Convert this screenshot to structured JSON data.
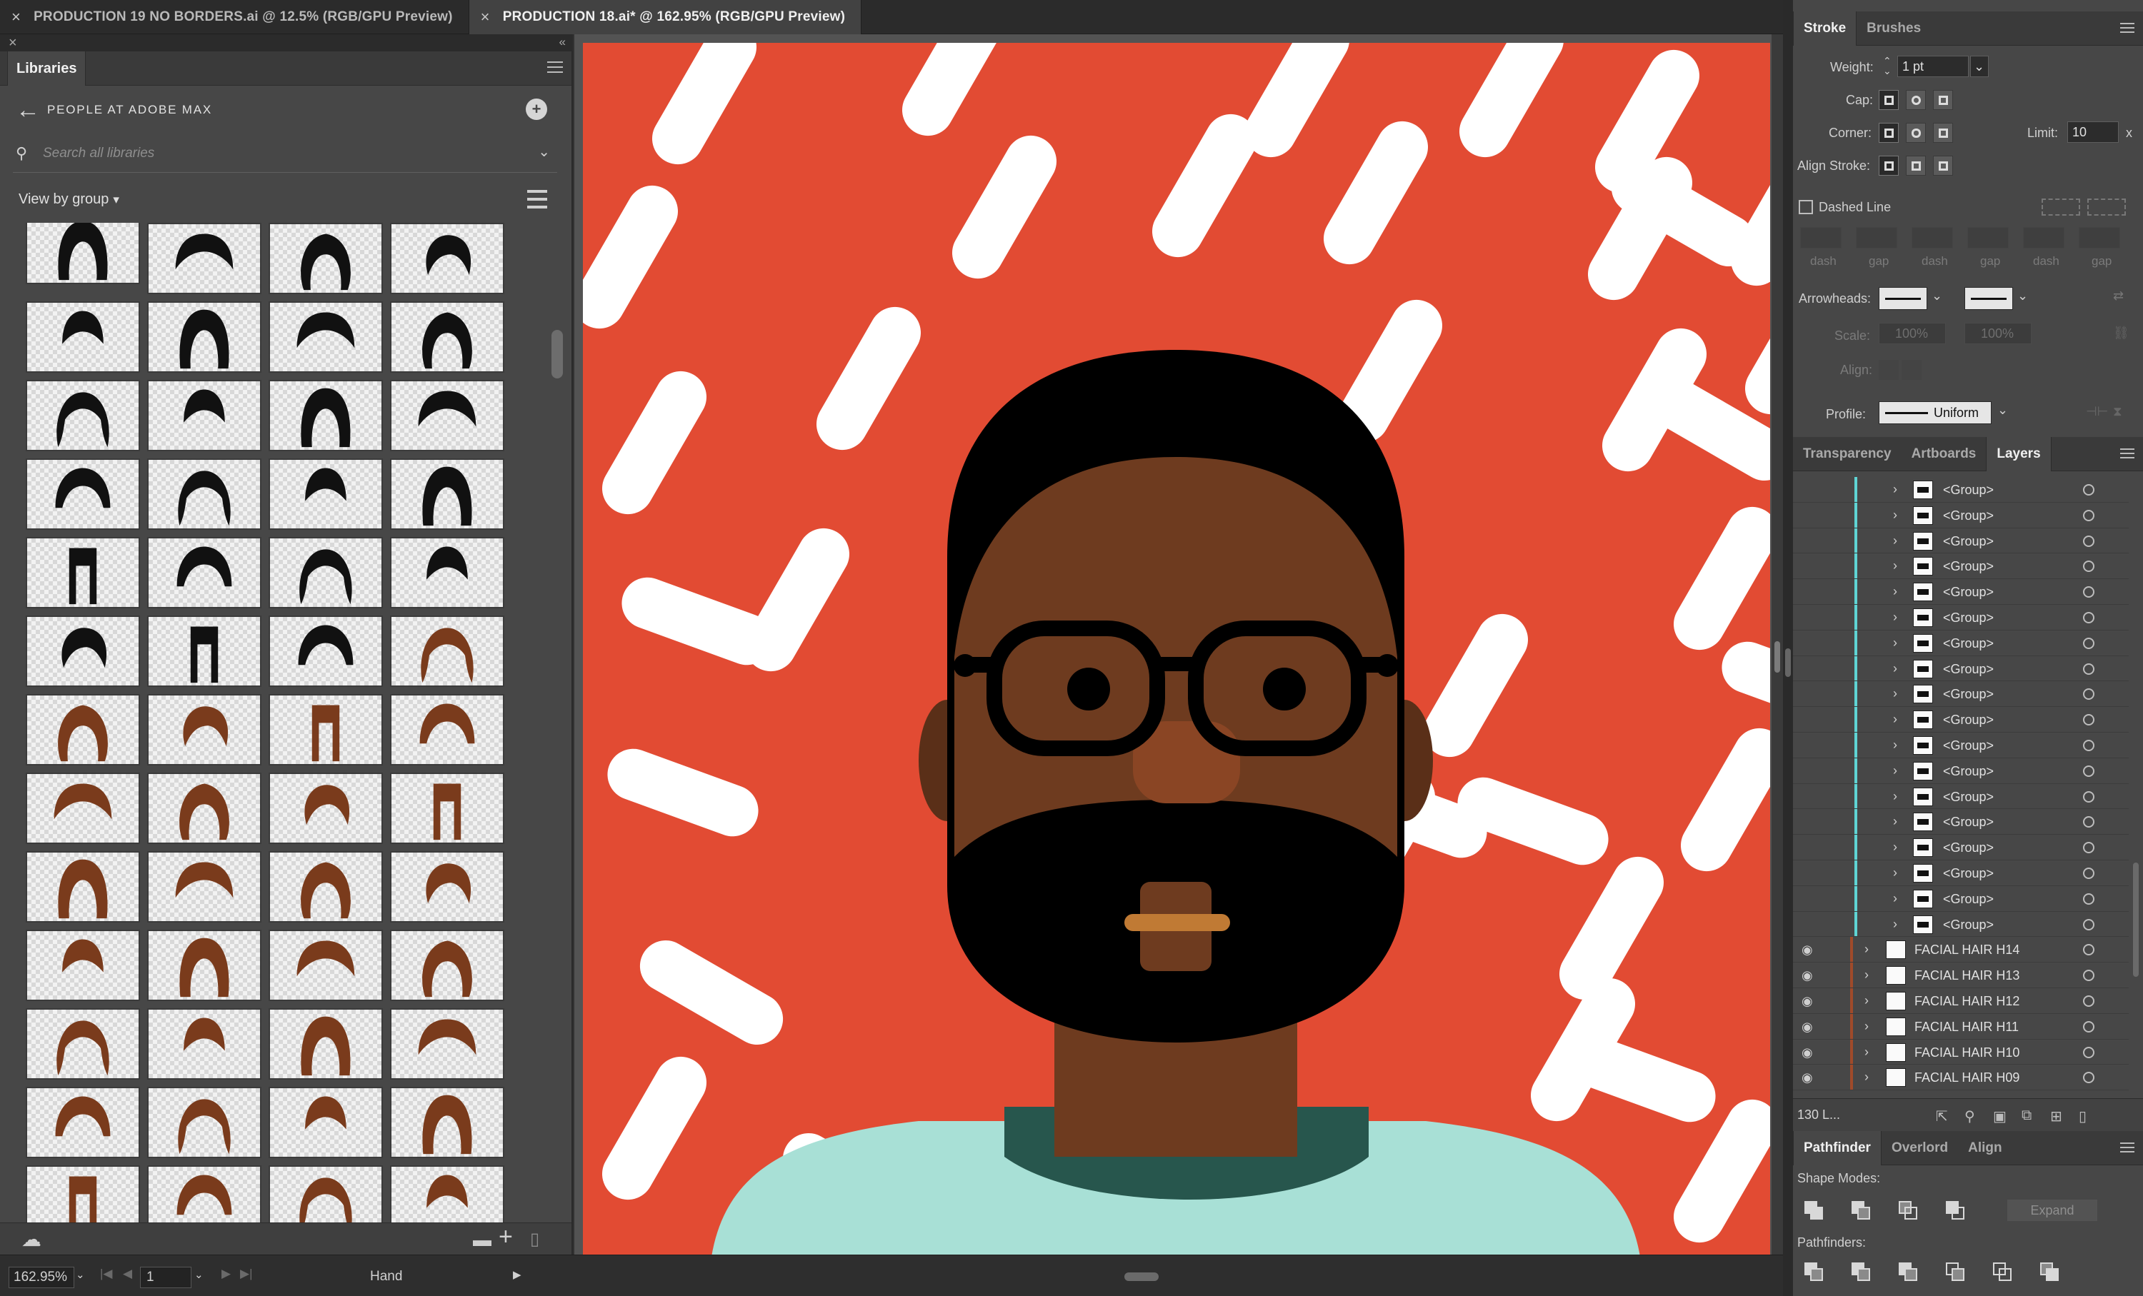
{
  "document_tabs": [
    {
      "label": "PRODUCTION 19 NO BORDERS.ai @ 12.5% (RGB/GPU Preview)",
      "active": false
    },
    {
      "label": "PRODUCTION 18.ai* @ 162.95% (RGB/GPU Preview)",
      "active": true
    }
  ],
  "libraries": {
    "tab_label": "Libraries",
    "library_name": "PEOPLE AT ADOBE MAX",
    "search_placeholder": "Search all libraries",
    "view_by": "View by group",
    "thumbnail_rows": 13,
    "thumbnail_columns": 4,
    "thumbnail_colors": {
      "black_hair_rows": 5,
      "black_hair_row6_count": 3,
      "hair_black": "#111111",
      "hair_brown": "#7a3b1c"
    }
  },
  "canvas": {
    "background": "#e24b33",
    "pattern": "#ffffff",
    "skin": "#6e3b1f",
    "hair": "#000000",
    "nose": "#8a4524",
    "mouth": "#c07a34",
    "shirt": "#a8e0d6",
    "collar": "#27564d"
  },
  "status_bar": {
    "zoom": "162.95%",
    "page": "1",
    "tool": "Hand"
  },
  "stroke_panel": {
    "tabs": [
      "Stroke",
      "Brushes"
    ],
    "active_tab": "Stroke",
    "weight_label": "Weight:",
    "weight_value": "1 pt",
    "cap_label": "Cap:",
    "corner_label": "Corner:",
    "limit_label": "Limit:",
    "limit_value": "10",
    "limit_unit": "x",
    "align_stroke_label": "Align Stroke:",
    "dashed_line_label": "Dashed Line",
    "dash_labels": [
      "dash",
      "gap",
      "dash",
      "gap",
      "dash",
      "gap"
    ],
    "arrowheads_label": "Arrowheads:",
    "scale_label": "Scale:",
    "scale_values": [
      "100%",
      "100%"
    ],
    "align_label": "Align:",
    "profile_label": "Profile:",
    "profile_value": "Uniform"
  },
  "layers_panel": {
    "tabs": [
      "Transparency",
      "Artboards",
      "Layers"
    ],
    "active_tab": "Layers",
    "group_rows": [
      "<Group>",
      "<Group>",
      "<Group>",
      "<Group>",
      "<Group>",
      "<Group>",
      "<Group>",
      "<Group>",
      "<Group>",
      "<Group>",
      "<Group>",
      "<Group>",
      "<Group>",
      "<Group>",
      "<Group>",
      "<Group>",
      "<Group>",
      "<Group>"
    ],
    "layer_rows": [
      "FACIAL HAIR H14",
      "FACIAL HAIR H13",
      "FACIAL HAIR H12",
      "FACIAL HAIR H11",
      "FACIAL HAIR H10",
      "FACIAL HAIR H09"
    ],
    "group_bar_color": "#5fd4d4",
    "layer_bar_color": "#a04a2a",
    "count_label": "130 L..."
  },
  "pathfinder_panel": {
    "tabs": [
      "Pathfinder",
      "Overlord",
      "Align"
    ],
    "active_tab": "Pathfinder",
    "shape_modes_label": "Shape Modes:",
    "expand_label": "Expand",
    "pathfinders_label": "Pathfinders:"
  }
}
